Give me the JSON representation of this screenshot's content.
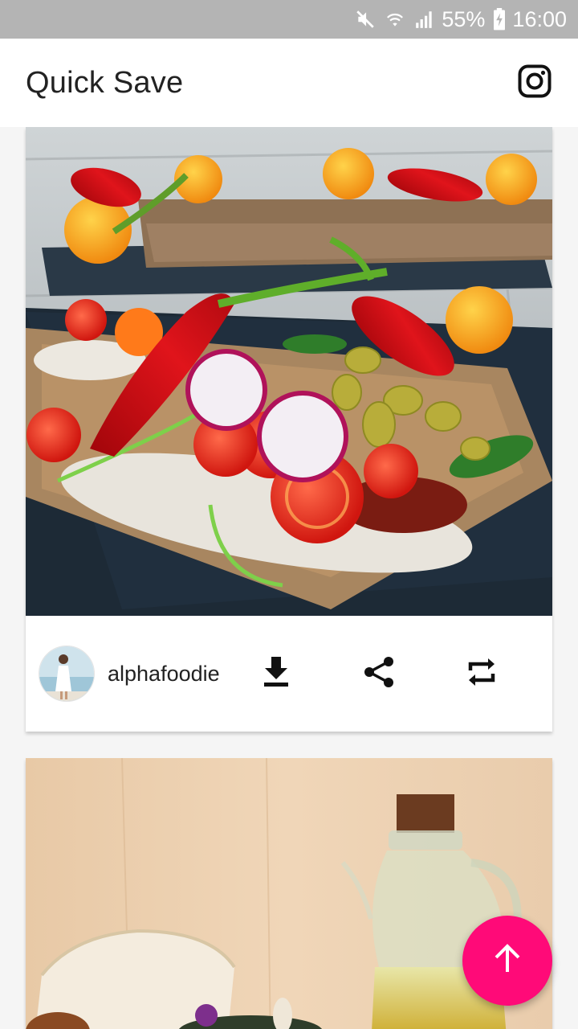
{
  "status_bar": {
    "battery_percent": "55%",
    "time": "16:00",
    "icons": [
      "mute-icon",
      "wifi-icon",
      "signal-icon",
      "battery-charging-icon"
    ]
  },
  "app_bar": {
    "title": "Quick Save",
    "action_icon": "instagram-icon"
  },
  "feed": {
    "posts": [
      {
        "username": "alphafoodie",
        "actions": [
          "download-icon",
          "share-icon",
          "repost-icon"
        ]
      }
    ]
  },
  "fab": {
    "icon": "arrow-up-icon"
  },
  "colors": {
    "status_bar": "#b4b4b4",
    "app_bar": "#ffffff",
    "fab": "#ff0a78",
    "text": "#222222"
  }
}
